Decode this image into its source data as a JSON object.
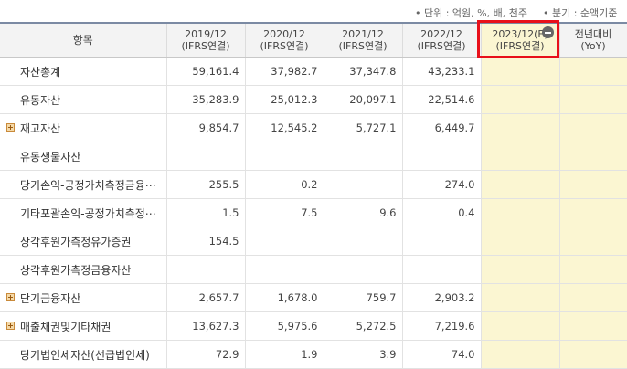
{
  "unit_note": {
    "unit": "• 단위 : 억원, %, 배, 천주",
    "basis": "• 분기 : 순액기준"
  },
  "header": {
    "item": "항목",
    "columns": [
      {
        "period": "2019/12",
        "basis": "(IFRS연결)"
      },
      {
        "period": "2020/12",
        "basis": "(IFRS연결)"
      },
      {
        "period": "2021/12",
        "basis": "(IFRS연결)"
      },
      {
        "period": "2022/12",
        "basis": "(IFRS연결)"
      },
      {
        "period": "2023/12(E)",
        "basis": "(IFRS연결)"
      },
      {
        "period": "전년대비",
        "basis": "(YoY)"
      }
    ]
  },
  "rows": [
    {
      "name": "자산총계",
      "expandable": false,
      "values": [
        "59,161.4",
        "37,982.7",
        "37,347.8",
        "43,233.1",
        "",
        ""
      ]
    },
    {
      "name": "유동자산",
      "expandable": false,
      "values": [
        "35,283.9",
        "25,012.3",
        "20,097.1",
        "22,514.6",
        "",
        ""
      ]
    },
    {
      "name": "재고자산",
      "expandable": true,
      "values": [
        "9,854.7",
        "12,545.2",
        "5,727.1",
        "6,449.7",
        "",
        ""
      ]
    },
    {
      "name": "유동생물자산",
      "expandable": false,
      "values": [
        "",
        "",
        "",
        "",
        "",
        ""
      ]
    },
    {
      "name": "당기손익-공정가치측정금융⋯",
      "expandable": false,
      "values": [
        "255.5",
        "0.2",
        "",
        "274.0",
        "",
        ""
      ]
    },
    {
      "name": "기타포괄손익-공정가치측정⋯",
      "expandable": false,
      "values": [
        "1.5",
        "7.5",
        "9.6",
        "0.4",
        "",
        ""
      ]
    },
    {
      "name": "상각후원가측정유가증권",
      "expandable": false,
      "values": [
        "154.5",
        "",
        "",
        "",
        "",
        ""
      ]
    },
    {
      "name": "상각후원가측정금융자산",
      "expandable": false,
      "values": [
        "",
        "",
        "",
        "",
        "",
        ""
      ]
    },
    {
      "name": "단기금융자산",
      "expandable": true,
      "values": [
        "2,657.7",
        "1,678.0",
        "759.7",
        "2,903.2",
        "",
        ""
      ]
    },
    {
      "name": "매출채권및기타채권",
      "expandable": true,
      "values": [
        "13,627.3",
        "5,975.6",
        "5,272.5",
        "7,219.6",
        "",
        ""
      ]
    },
    {
      "name": "당기법인세자산(선급법인세)",
      "expandable": false,
      "values": [
        "72.9",
        "1.9",
        "3.9",
        "74.0",
        "",
        ""
      ]
    }
  ],
  "colors": {
    "estimate_bg": "#fbf6d2",
    "highlight": "#e8101a",
    "header_bg": "#f3f3f3"
  }
}
